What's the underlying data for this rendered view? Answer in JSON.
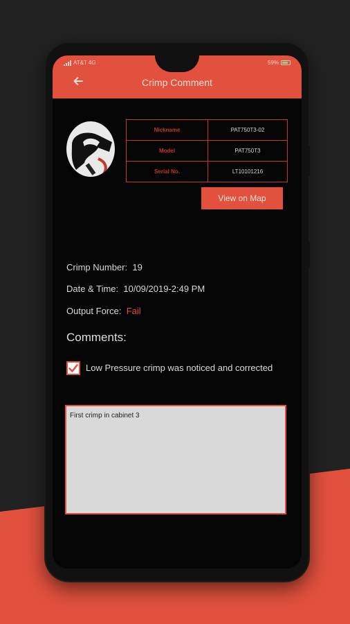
{
  "status_bar": {
    "carrier": "AT&T 4G",
    "battery": "59%"
  },
  "header": {
    "title": "Crimp Comment",
    "back_icon": "arrow-left-icon"
  },
  "device": {
    "rows": [
      {
        "label": "Nickname",
        "value": "PAT750T3-02"
      },
      {
        "label": "Model",
        "value": "PAT750T3"
      },
      {
        "label": "Serial No.",
        "value": "LT10101216"
      }
    ],
    "map_button": "View on Map"
  },
  "crimp": {
    "number_label": "Crimp Number:",
    "number_value": "19",
    "datetime_label": "Date & Time:",
    "datetime_value": "10/09/2019-2:49 PM",
    "force_label": "Output Force:",
    "force_value": "Fail"
  },
  "comments": {
    "heading": "Comments:",
    "checkbox_label": "Low Pressure crimp was noticed and corrected",
    "checkbox_checked": true,
    "text": "First crimp in cabinet 3"
  },
  "colors": {
    "accent": "#e2513d",
    "background": "#222222",
    "screen": "#050505"
  }
}
